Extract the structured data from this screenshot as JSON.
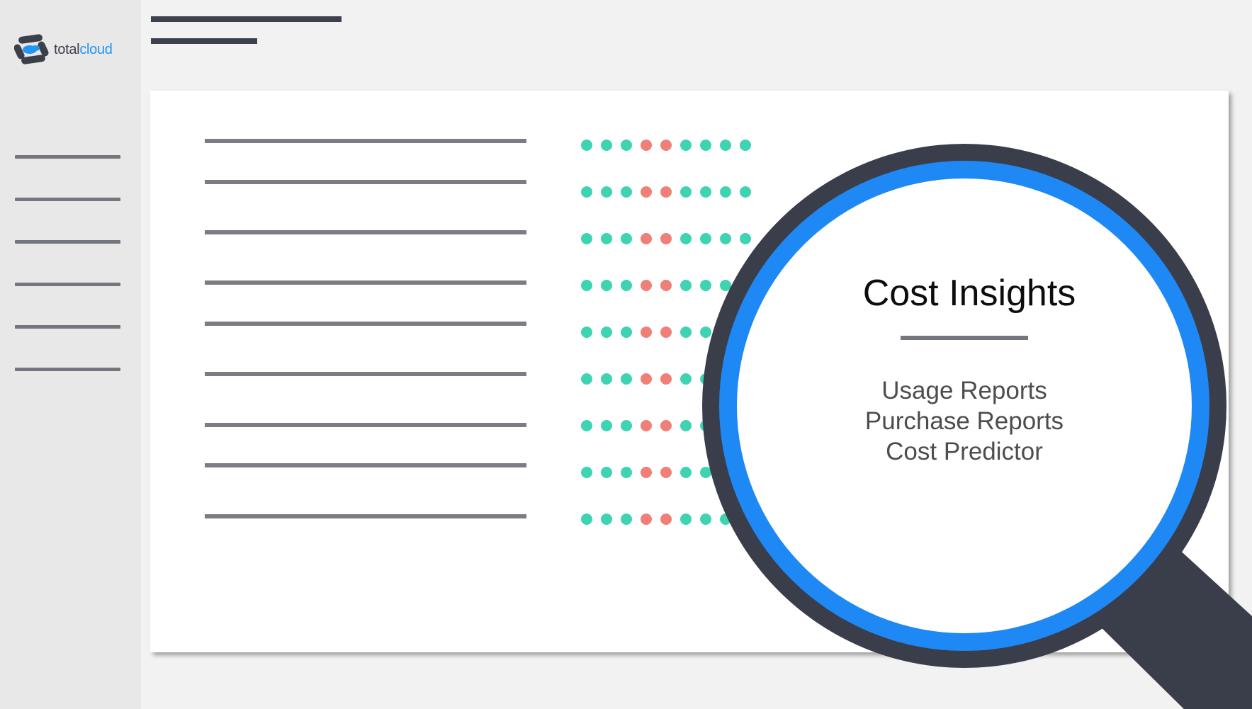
{
  "brand": {
    "name_part1": "total",
    "name_part2": "cloud",
    "icon": "totalcloud-logo-icon",
    "colors": {
      "primary": "#2196f3",
      "dark": "#3b3f4a"
    }
  },
  "sidebar": {
    "items": [
      {
        "icon": "nav-placeholder-line"
      },
      {
        "icon": "nav-placeholder-line"
      },
      {
        "icon": "nav-placeholder-line"
      },
      {
        "icon": "nav-placeholder-line"
      },
      {
        "icon": "nav-placeholder-line"
      },
      {
        "icon": "nav-placeholder-line"
      }
    ]
  },
  "colors": {
    "ok": "#3ed4b2",
    "alert": "#f07f7a",
    "lens_ring": "#1e88f5",
    "lens_frame": "#3a3d4a"
  },
  "rows": [
    [
      "ok",
      "ok",
      "ok",
      "alert",
      "alert",
      "ok",
      "ok",
      "ok",
      "ok"
    ],
    [
      "ok",
      "ok",
      "ok",
      "alert",
      "alert",
      "ok",
      "ok",
      "ok",
      "ok"
    ],
    [
      "ok",
      "ok",
      "ok",
      "alert",
      "alert",
      "ok",
      "ok",
      "ok",
      "ok"
    ],
    [
      "ok",
      "ok",
      "ok",
      "alert",
      "alert",
      "ok",
      "ok",
      "ok",
      "ok"
    ],
    [
      "ok",
      "ok",
      "ok",
      "alert",
      "alert",
      "ok",
      "ok",
      "ok",
      "ok"
    ],
    [
      "ok",
      "ok",
      "ok",
      "alert",
      "alert",
      "ok",
      "ok",
      "ok",
      "ok"
    ],
    [
      "ok",
      "ok",
      "ok",
      "alert",
      "alert",
      "ok",
      "ok",
      "ok",
      "ok"
    ],
    [
      "ok",
      "ok",
      "ok",
      "alert",
      "alert",
      "ok",
      "ok",
      "ok",
      "ok"
    ],
    [
      "ok",
      "ok",
      "ok",
      "alert",
      "alert",
      "ok",
      "ok",
      "ok",
      "ok"
    ]
  ],
  "lens": {
    "title": "Cost Insights",
    "links": [
      "Usage Reports",
      "Purchase Reports",
      "Cost Predictor"
    ],
    "icon": "magnifying-glass-icon"
  }
}
